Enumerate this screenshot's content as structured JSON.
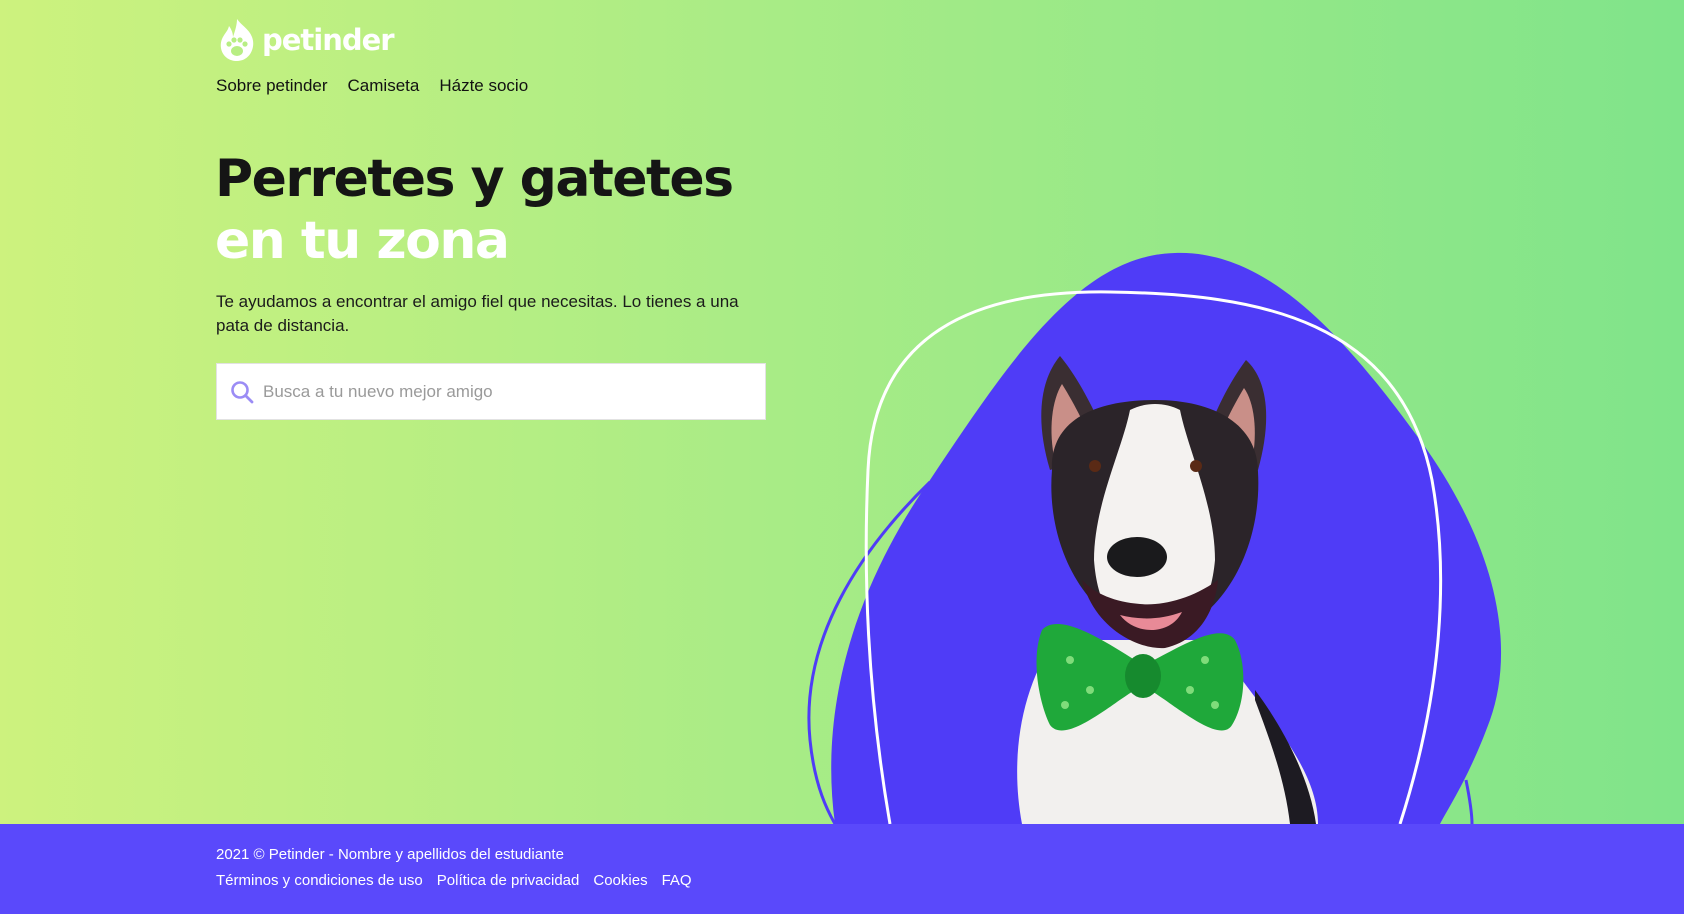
{
  "brand": {
    "name": "petinder",
    "logo_icon": "paw-flame-icon"
  },
  "nav": [
    {
      "label": "Sobre petinder"
    },
    {
      "label": "Camiseta"
    },
    {
      "label": "Házte socio"
    }
  ],
  "hero": {
    "headline_line1": "Perretes y gatetes",
    "headline_line2": "en tu zona",
    "subtitle": "Te ayudamos a encontrar el amigo fiel que necesitas. Lo tienes a una pata de distancia.",
    "image": "dog-with-green-bowtie"
  },
  "search": {
    "icon": "search-icon",
    "placeholder": "Busca a tu nuevo mejor amigo",
    "value": ""
  },
  "footer": {
    "copyright": "2021 © Petinder - Nombre y apellidos del estudiante",
    "links": [
      {
        "label": "Términos y condiciones de uso"
      },
      {
        "label": "Política de privacidad"
      },
      {
        "label": "Cookies"
      },
      {
        "label": "FAQ"
      }
    ]
  },
  "colors": {
    "gradient_start": "#cdf27e",
    "gradient_end": "#80e48a",
    "accent": "#5a49fb",
    "headline_dark": "#151515",
    "white": "#ffffff"
  }
}
